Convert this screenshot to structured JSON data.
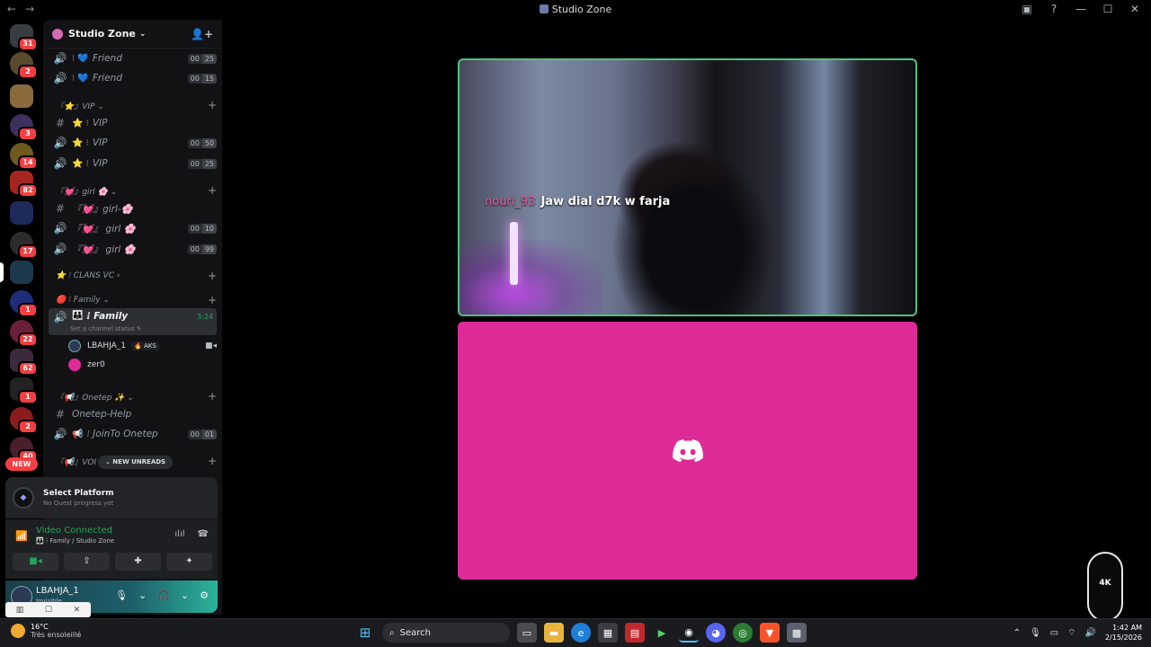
{
  "window": {
    "title": "Studio Zone",
    "back": "←",
    "forward": "→",
    "inbox_icon": "inbox-icon",
    "help": "?",
    "minimize": "—",
    "maximize": "☐",
    "close": "✕"
  },
  "rail": {
    "servers": [
      {
        "name": "home",
        "badge": "31",
        "color": "#3a3c43"
      },
      {
        "name": "server-2",
        "badge": "2",
        "color": "#5a4b2c"
      },
      {
        "name": "server-3",
        "badge": "",
        "color": "#8a6a3c"
      },
      {
        "name": "server-4",
        "badge": "3",
        "color": "#3d2f5e"
      },
      {
        "name": "server-5",
        "badge": "14",
        "color": "#6e5a1e"
      },
      {
        "name": "server-6",
        "badge": "82",
        "color": "#a4261e"
      },
      {
        "name": "folder",
        "badge": "",
        "color": "#1e2a5a"
      },
      {
        "name": "server-8",
        "badge": "17",
        "color": "#2c2c2c"
      },
      {
        "name": "studio-zone",
        "badge": "",
        "color": "#1c3a4c"
      },
      {
        "name": "server-10",
        "badge": "1",
        "color": "#1d2d7a"
      },
      {
        "name": "server-11",
        "badge": "22",
        "color": "#6a1f3a"
      },
      {
        "name": "server-12",
        "badge": "62",
        "color": "#3a2a3c"
      },
      {
        "name": "server-13",
        "badge": "1",
        "color": "#222"
      },
      {
        "name": "server-14",
        "badge": "2",
        "color": "#8a1c1c"
      },
      {
        "name": "server-15",
        "badge": "40",
        "color": "#4a1e2a"
      }
    ],
    "new_label": "NEW"
  },
  "guild": {
    "name": "Studio Zone",
    "chevron": "⌄",
    "invite_icon": "add-member-icon"
  },
  "channels": {
    "friend1": {
      "name": "Friend",
      "prefix": "⁝ 💙",
      "u1": "00",
      "u2": "25"
    },
    "friend2": {
      "name": "Friend",
      "prefix": "⁝ 💙",
      "u1": "00",
      "u2": "15"
    },
    "cat_vip": {
      "label": "『⭐』VIP ⌄",
      "plus": "+"
    },
    "vip_text": {
      "name": "VIP",
      "prefix": "⭐ ⁝"
    },
    "vip1": {
      "name": "VIP",
      "prefix": "⭐ ⁝",
      "u1": "00",
      "u2": "50"
    },
    "vip2": {
      "name": "VIP",
      "prefix": "⭐ ⁝",
      "u1": "00",
      "u2": "25"
    },
    "cat_girl": {
      "label": "『💓』girl 🌸 ⌄",
      "plus": "+"
    },
    "girl_text": {
      "name": "『💓』girl-🌸"
    },
    "girl1": {
      "name": "『💓』 girl 🌸",
      "u1": "00",
      "u2": "10"
    },
    "girl2": {
      "name": "『💓』 girl 🌸",
      "u1": "00",
      "u2": "99"
    },
    "cat_clans": {
      "label": "⭐ ⁝ CLANS VC ›",
      "plus": "+"
    },
    "cat_family": {
      "label": "🔴 ⁝ Family ⌄",
      "plus": "+"
    },
    "family": {
      "name": "⁝ Family",
      "prefix": "👪",
      "time": "3:24",
      "status": "Set a channel status ✎"
    },
    "user1": {
      "name": "LBAHJA_1",
      "tag": "🔥 AKS",
      "cam": "▶"
    },
    "user2": {
      "name": "zer0"
    },
    "cat_onetep": {
      "label": "『📢』Onetep ✨ ⌄",
      "plus": "+"
    },
    "onetep_help": {
      "name": "Onetep-Help"
    },
    "onetep_join": {
      "name": "⁝ JoinTo Onetep",
      "prefix": "📢",
      "u1": "00",
      "u2": "01"
    },
    "cat_voi": {
      "label": "『📢』VOI",
      "plus": "+"
    },
    "new_unreads": "⌄  NEW UNREADS"
  },
  "quest": {
    "title": "Select Platform",
    "subtitle": "No Quest progress yet"
  },
  "voice": {
    "status": "Video Connected",
    "channel": "👪 ⁝ Family / Studio Zone"
  },
  "user": {
    "name": "LBAHJA_1",
    "status": "Invisible"
  },
  "stage": {
    "caption_user": "nouri_93",
    "caption_text": "Jaw dial d7k w farja",
    "badge_text": "4K"
  },
  "taskbar": {
    "temp": "16°C",
    "weather": "Très ensoleillé",
    "search": "Search",
    "time": "1:42 AM",
    "date": "2/15/2026"
  }
}
